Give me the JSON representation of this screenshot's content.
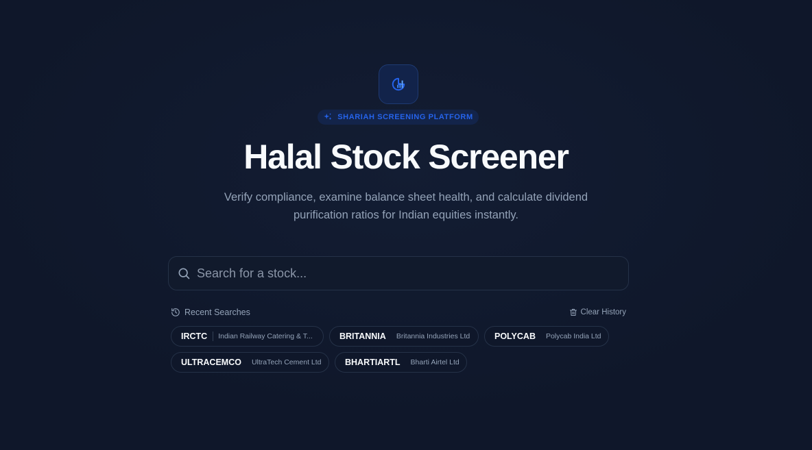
{
  "header": {
    "logo_icon": "chart-pie-icon",
    "badge_icon": "sparkles-icon",
    "badge_label": "SHARIAH SCREENING PLATFORM",
    "title": "Halal Stock Screener",
    "subtitle": "Verify compliance, examine balance sheet health, and calculate dividend purification ratios for Indian equities instantly."
  },
  "search": {
    "icon": "search-icon",
    "placeholder": "Search for a stock...",
    "value": ""
  },
  "recent": {
    "icon": "history-icon",
    "label": "Recent Searches",
    "clear_icon": "trash-icon",
    "clear_label": "Clear History",
    "items": [
      {
        "symbol": "IRCTC",
        "name": "Indian Railway Catering & T..."
      },
      {
        "symbol": "BRITANNIA",
        "name": "Britannia Industries Ltd"
      },
      {
        "symbol": "POLYCAB",
        "name": "Polycab India Ltd"
      },
      {
        "symbol": "ULTRACEMCO",
        "name": "UltraTech Cement Ltd"
      },
      {
        "symbol": "BHARTIARTL",
        "name": "Bharti Airtel Ltd"
      }
    ]
  },
  "colors": {
    "background": "#0f172a",
    "accent": "#2563eb",
    "muted_text": "#94a3b8"
  }
}
